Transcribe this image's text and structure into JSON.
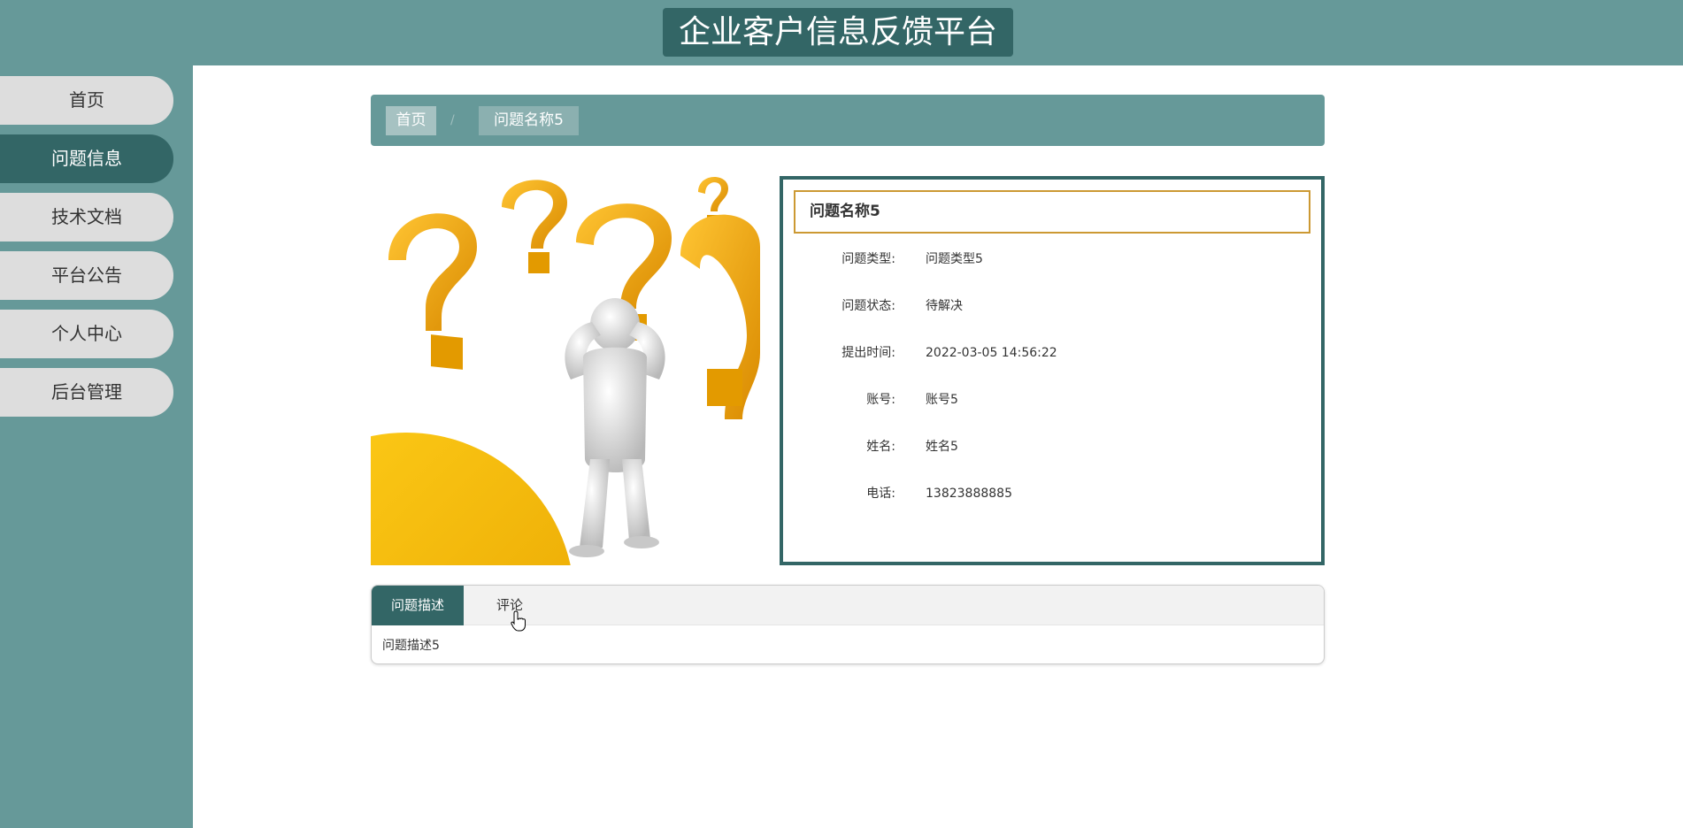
{
  "site": {
    "title": "企业客户信息反馈平台"
  },
  "nav": {
    "items": [
      {
        "label": "首页",
        "active": false
      },
      {
        "label": "问题信息",
        "active": true
      },
      {
        "label": "技术文档",
        "active": false
      },
      {
        "label": "平台公告",
        "active": false
      },
      {
        "label": "个人中心",
        "active": false
      },
      {
        "label": "后台管理",
        "active": false
      }
    ]
  },
  "breadcrumb": {
    "home": "首页",
    "separator": "/",
    "current": "问题名称5"
  },
  "detail": {
    "title": "问题名称5",
    "fields": [
      {
        "label": "问题类型:",
        "value": "问题类型5"
      },
      {
        "label": "问题状态:",
        "value": "待解决"
      },
      {
        "label": "提出时间:",
        "value": "2022-03-05 14:56:22"
      },
      {
        "label": "账号:",
        "value": "账号5"
      },
      {
        "label": "姓名:",
        "value": "姓名5"
      },
      {
        "label": "电话:",
        "value": "13823888885"
      }
    ]
  },
  "tabs": {
    "items": [
      {
        "label": "问题描述",
        "active": true
      },
      {
        "label": "评论",
        "active": false
      }
    ],
    "content": "问题描述5"
  },
  "colors": {
    "primary": "#336666",
    "secondary": "#669999",
    "nav_inactive": "#dddddd",
    "title_border": "#cc9933",
    "question_mark": "#f2a600"
  },
  "icons": {
    "cursor": "hand-pointer-icon"
  }
}
